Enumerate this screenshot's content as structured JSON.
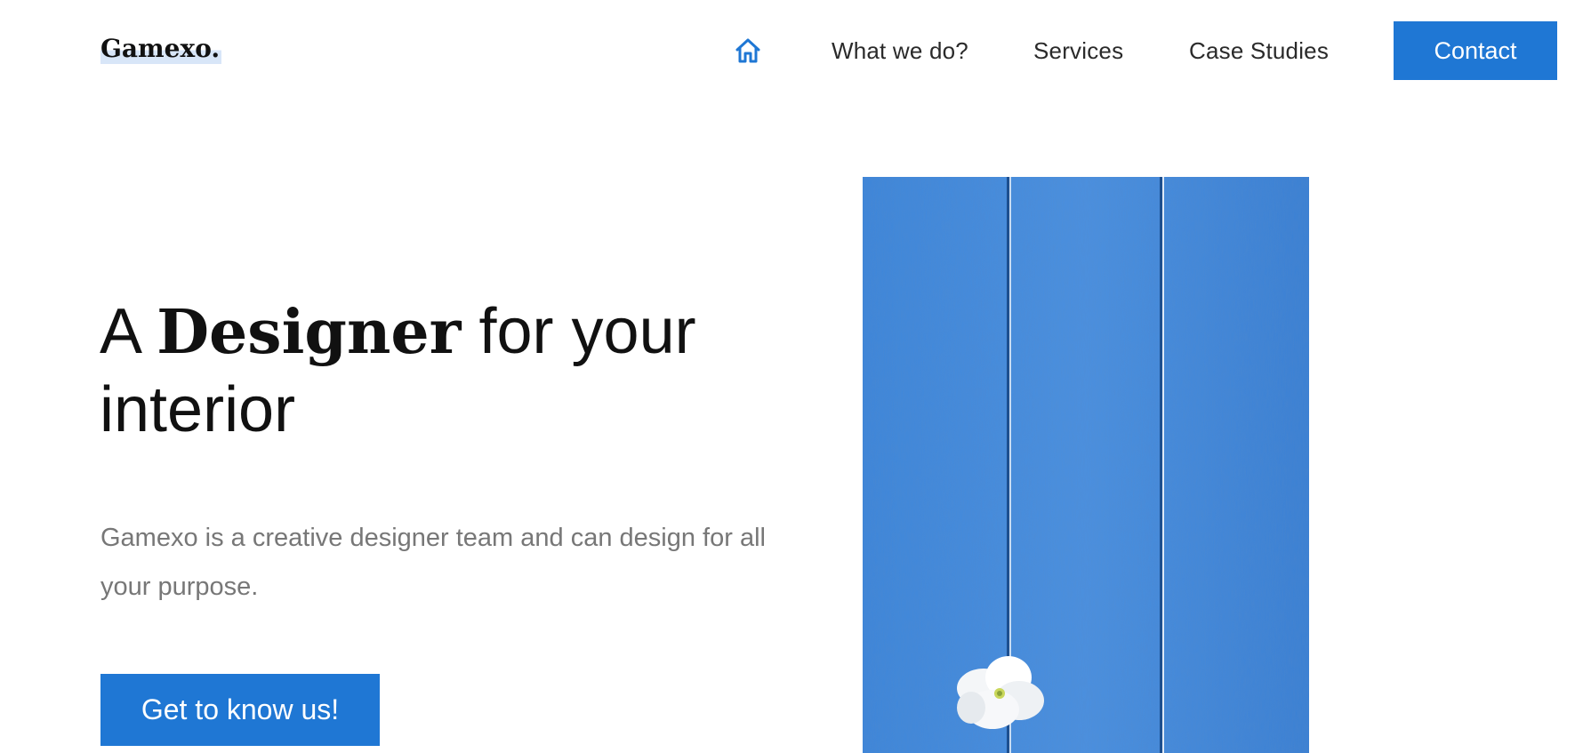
{
  "brand": {
    "name": "Gamexo."
  },
  "nav": {
    "home_icon": "home-icon",
    "items": [
      {
        "label": "What we do?"
      },
      {
        "label": "Services"
      },
      {
        "label": "Case Studies"
      }
    ],
    "contact_label": "Contact"
  },
  "hero": {
    "title_prefix": "A ",
    "title_bold": "Designer",
    "title_suffix": " for your interior",
    "description": "Gamexo is a creative designer team and can design for all your purpose.",
    "cta_label": "Get to know us!",
    "image": "blue-wooden-planks-with-white-flower"
  },
  "colors": {
    "accent": "#1f77d4",
    "text": "#111111",
    "muted_text": "#777777",
    "image_blue": "#3a82d6"
  }
}
